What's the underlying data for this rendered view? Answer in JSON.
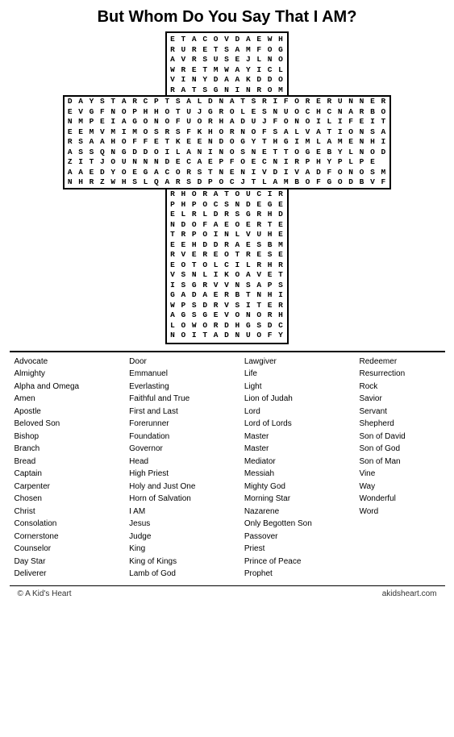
{
  "title": "But Whom Do You Say That I AM?",
  "grid": {
    "top_rows": [
      "E T A C O V D A E W H",
      "R U R E T S A M F O G",
      "A V R S U S E J L N O",
      "W R E T M W A Y I C L",
      "V I N Y D A A K D D O",
      "R A T S G N I N R O M"
    ],
    "middle_rows": [
      "D A Y S T A R C P T S A L D N A T S R I F O R E R U N N E R",
      "E V G F N O P H H O T U J G R O L E S N U O C H C N A R B O",
      "N M P E I A G O N O F U O R H A D U J F O N O I L I F E I T",
      "E E M V M I M O S R S F K H O R N O F S A L V A T I O N S A",
      "R S A A H O F F E T K E E N D O G Y T H G I M L A M E N H I",
      "A S S Q N G D D O I L A N I N O S N E T T O G E B Y L N O D",
      "Z I T J O U N N N D E C A E P F O E C N I R P H Y P L P E",
      "A A E D Y O E G A C O R S T N E N I V D I V A D F O N O S M",
      "N H R Z W H S L Q A R S D P O C J T L A M B O F G O D B V F"
    ],
    "bottom_rows": [
      "R H O R A T O U C I R",
      "P H P O C S N D E G E",
      "E L R L D R S G R H D",
      "N D O F A E O E R T E",
      "T R P O I N L V U H E",
      "E E H D D R A E S B M",
      "R V E R E O T R E S E",
      "E O T O L C I L R H R",
      "V S N L I K O A V E T",
      "I S G R V V N S A P S",
      "G A D A E R B T N H I",
      "W P S D R V S I T E R",
      "A G S G E V O N O R H",
      "L O W O R D H G S D C",
      "N O I T A D N U O F Y"
    ]
  },
  "words": {
    "col1": [
      "Advocate",
      "Almighty",
      "Alpha and Omega",
      "Amen",
      "Apostle",
      "Beloved Son",
      "Bishop",
      "Branch",
      "Bread",
      "Captain",
      "Carpenter",
      "Chosen",
      "Christ",
      "Consolation",
      "Cornerstone",
      "Counselor",
      "Day Star",
      "Deliverer"
    ],
    "col2": [
      "Door",
      "Emmanuel",
      "Everlasting",
      "Faithful and True",
      "First and Last",
      "Forerunner",
      "Foundation",
      "Governor",
      "Head",
      "High Priest",
      "Holy and Just One",
      "Horn of Salvation",
      "I AM",
      "Jesus",
      "Judge",
      "King",
      "King of Kings",
      "Lamb of God"
    ],
    "col3": [
      "Lawgiver",
      "Life",
      "Light",
      "Lion of Judah",
      "Lord",
      "Lord of Lords",
      "Master",
      "Master",
      "Mediator",
      "Messiah",
      "Mighty God",
      "Morning Star",
      "Nazarene",
      "Only Begotten Son",
      "Passover",
      "Priest",
      "Prince of Peace",
      "Prophet"
    ],
    "col4": [
      "Redeemer",
      "Resurrection",
      "Rock",
      "Savior",
      "Servant",
      "Shepherd",
      "Son of David",
      "Son of God",
      "Son of Man",
      "Vine",
      "Way",
      "Wonderful",
      "Word"
    ]
  },
  "footer": {
    "left": "© A Kid's Heart",
    "right": "akidsheart.com"
  }
}
